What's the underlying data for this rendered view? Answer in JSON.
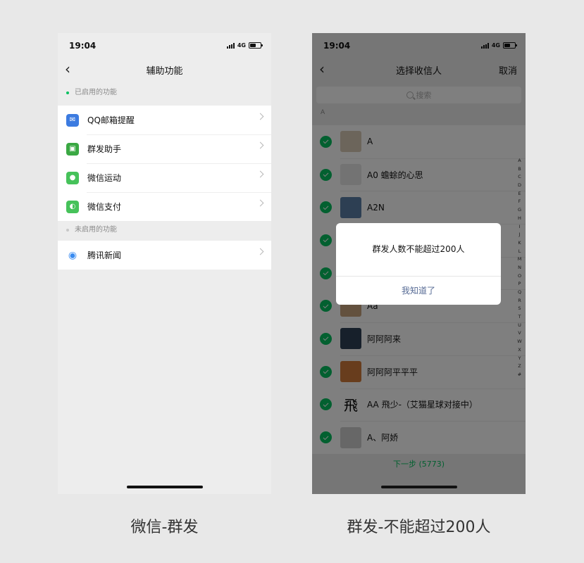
{
  "left_screen": {
    "status_time": "19:04",
    "network": "4G",
    "nav_title": "辅助功能",
    "enabled_label": "已启用的功能",
    "enabled_items": [
      {
        "label": "QQ邮箱提醒",
        "icon": "mail-icon",
        "color": "#3c7be0"
      },
      {
        "label": "群发助手",
        "icon": "broadcast-icon",
        "color": "#3aa843"
      },
      {
        "label": "微信运动",
        "icon": "wechat-sport-icon",
        "color": "#46c25a"
      },
      {
        "label": "微信支付",
        "icon": "wechat-pay-icon",
        "color": "#46c25a"
      }
    ],
    "disabled_label": "未启用的功能",
    "disabled_items": [
      {
        "label": "腾讯新闻",
        "icon": "tencent-news-icon",
        "color": "#3b8cf0"
      }
    ]
  },
  "right_screen": {
    "status_time": "19:04",
    "network": "4G",
    "nav_title": "选择收信人",
    "cancel_label": "取消",
    "search_placeholder": "搜索",
    "letter_header": "A",
    "contacts": [
      {
        "name": "A",
        "avatar_color": "#d9cbb6"
      },
      {
        "name": "A0 蟾蜍的心思",
        "avatar_color": "#e6e6e6"
      },
      {
        "name": "A2N",
        "avatar_color": "#5a7ea6"
      },
      {
        "name": "",
        "avatar_color": "#8fa58a"
      },
      {
        "name": "",
        "avatar_color": "#b59b7e"
      },
      {
        "name": "Aa",
        "avatar_color": "#c7a27c"
      },
      {
        "name": "阿阿阿来",
        "avatar_color": "#2f4156"
      },
      {
        "name": "阿阿阿平平平",
        "avatar_color": "#d17a3a"
      },
      {
        "name": "AA 飛少-（艾猫星球对接中）",
        "avatar_color": "#ffffff",
        "avatar_glyph": "飛"
      },
      {
        "name": "A、阿娇",
        "avatar_color": "#cfcfcf"
      }
    ],
    "alphabet": [
      "A",
      "B",
      "C",
      "D",
      "E",
      "F",
      "G",
      "H",
      "I",
      "J",
      "K",
      "L",
      "M",
      "N",
      "O",
      "P",
      "Q",
      "R",
      "S",
      "T",
      "U",
      "V",
      "W",
      "X",
      "Y",
      "Z",
      "#"
    ],
    "next_label": "下一步 (5773)",
    "dialog": {
      "message": "群发人数不能超过200人",
      "button_label": "我知道了"
    }
  },
  "captions": {
    "left": "微信-群发",
    "right": "群发-不能超过200人"
  },
  "colors": {
    "wechat_green": "#07c160",
    "dialog_link": "#576b95"
  }
}
